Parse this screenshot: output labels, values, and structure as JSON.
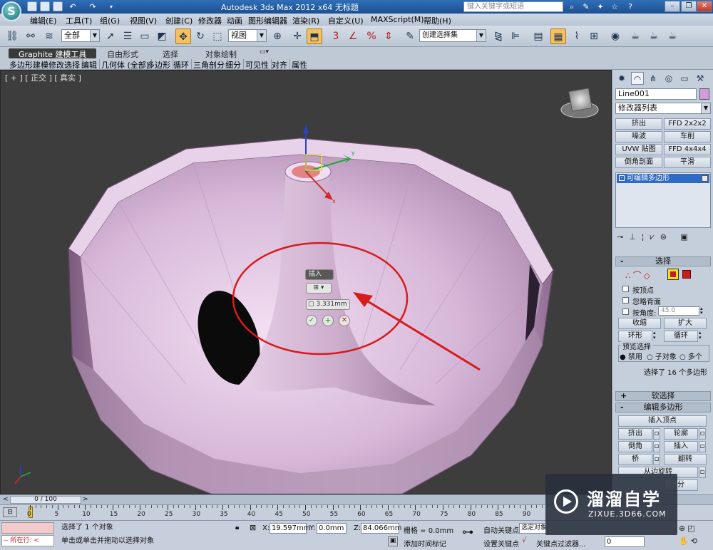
{
  "app": {
    "title": "Autodesk 3ds Max  2012 x64    无标题",
    "logo_letter": "S",
    "search_placeholder": "键入关键字或短语"
  },
  "menu": [
    "编辑(E)",
    "工具(T)",
    "组(G)",
    "视图(V)",
    "创建(C)",
    "修改器",
    "动画",
    "图形编辑器",
    "渲染(R)",
    "自定义(U)",
    "MAXScript(M)",
    "帮助(H)"
  ],
  "toolbar": {
    "selection_filter": "全部",
    "reference_coord": "视图",
    "named_selection": "创建选择集",
    "snap_labels": [
      "3",
      "%"
    ]
  },
  "ribbon": {
    "tabs": [
      "Graphite 建模工具",
      "自由形式",
      "选择",
      "对象绘制"
    ],
    "items": [
      "多边形建模",
      "修改选择",
      "编辑",
      "几何体 (全部)",
      "多边形",
      "循环",
      "三角剖分",
      "细分",
      "可见性",
      "对齐",
      "属性"
    ]
  },
  "viewport": {
    "label": "[ + ] [ 正交 ] [ 真实 ]",
    "caddy": {
      "title": "插入",
      "value": "3.331mm"
    },
    "gizmo_axes": [
      "z",
      "y",
      "x"
    ]
  },
  "command_panel": {
    "object_name": "Line001",
    "object_color": "#d39be0",
    "modifier_list": "修改器列表",
    "modifier_buttons": [
      "挤出",
      "FFD 2x2x2",
      "噪波",
      "车削",
      "UVW 贴图",
      "FFD 4x4x4",
      "倒角剖面",
      "平滑"
    ],
    "stack": [
      "可编辑多边形"
    ],
    "selection": {
      "title": "选择",
      "by_vertex": "按顶点",
      "ignore_backfacing": "忽略背面",
      "by_angle": "按角度:",
      "angle_value": "45.0",
      "shrink": "收缩",
      "grow": "扩大",
      "ring": "环形",
      "loop": "循环",
      "preview": "预览选择",
      "preview_off": "禁用",
      "preview_sub": "子对象",
      "preview_multi": "多个",
      "status": "选择了 16 个多边形"
    },
    "soft_selection": "软选择",
    "edit_polygons": {
      "title": "编辑多边形",
      "insert_vertex": "插入顶点",
      "buttons": [
        "挤出",
        "轮廓",
        "倒角",
        "插入",
        "桥",
        "翻转"
      ],
      "hinge": "从边旋转",
      "extra": [
        "分",
        "旋转"
      ]
    }
  },
  "timeline": {
    "frame": "0 / 100",
    "ticks": [
      "0",
      "5",
      "10",
      "15",
      "20",
      "25",
      "30",
      "35",
      "40",
      "45",
      "50",
      "55",
      "60",
      "65",
      "70",
      "75",
      "80",
      "85",
      "90"
    ]
  },
  "status": {
    "maxscript_label": "所在行:",
    "selected": "选择了 1 个对象",
    "prompt": "单击或单击并拖动以选择对象",
    "x_label": "X:",
    "x_value": "19.597mm",
    "y_label": "Y:",
    "y_value": "0.0mm",
    "z_label": "Z:",
    "z_value": "84.066mm",
    "grid": "栅格 = 0.0mm",
    "add_time_tag": "添加时间标记",
    "auto_key": "自动关键点",
    "auto_key_sel": "选定对象",
    "set_key": "设置关键点",
    "key_filters": "关键点过滤器...",
    "frame_value": "0"
  },
  "watermark": {
    "brand": "溜溜自学",
    "url": "ZIXUE.3D66.COM"
  },
  "colors": {
    "accent": "#f5c060",
    "annotation": "#d81b1b",
    "mesh": "#d9b6da"
  }
}
